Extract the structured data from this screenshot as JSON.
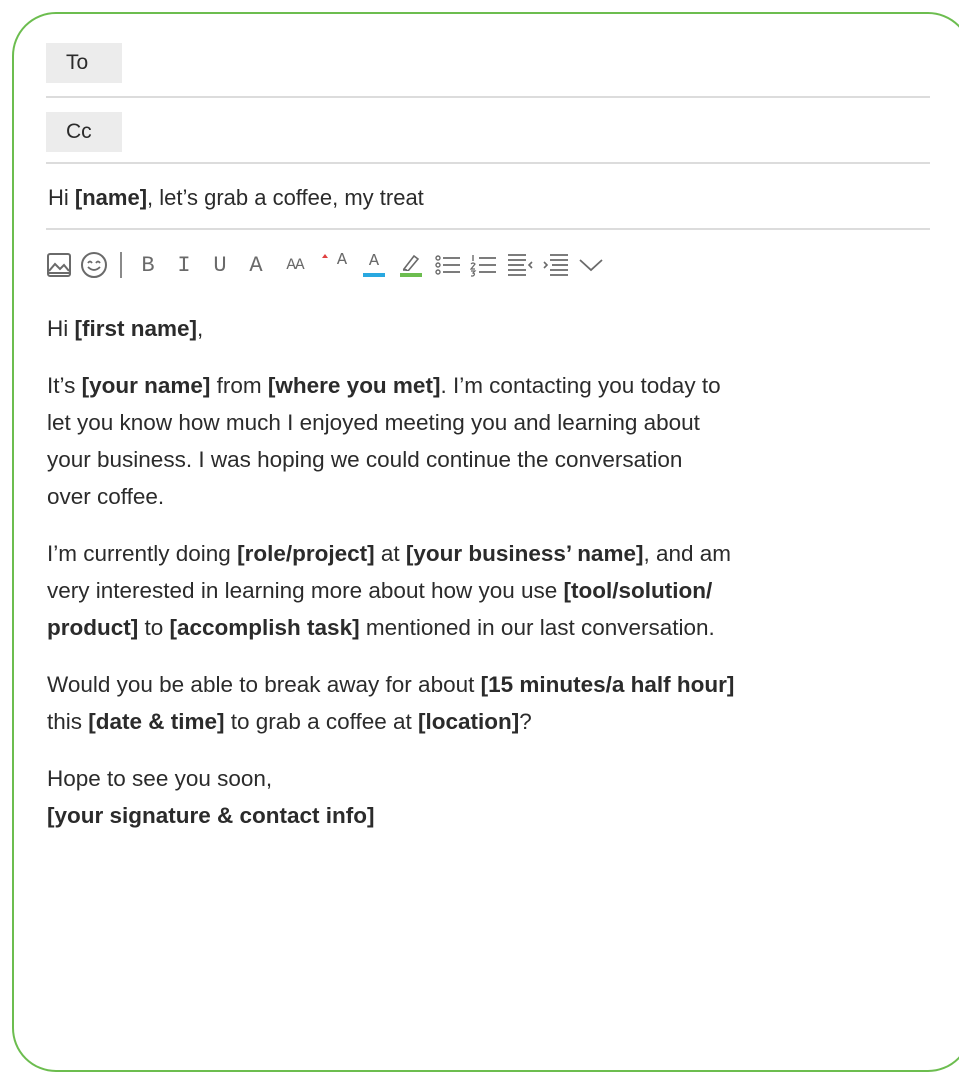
{
  "header": {
    "to_label": "To",
    "cc_label": "Cc"
  },
  "subject": {
    "prefix": "Hi ",
    "name_placeholder": "[name]",
    "suffix": ", let’s grab a coffee, my treat"
  },
  "toolbar": {
    "icons": [
      "image-icon",
      "emoji-icon"
    ],
    "bold_label": "B",
    "italic_label": "I",
    "underline_label": "U",
    "font_label": "A",
    "font_size_label": "AA",
    "superscript_label": "A",
    "text_color_label": "A",
    "text_color": "#29a8e0",
    "highlight_color": "#6cbd4f"
  },
  "body": {
    "greeting_prefix": "Hi ",
    "greeting_name": "[first name]",
    "greeting_suffix": ",",
    "p1": {
      "l1_a": "It’s ",
      "l1_b": "[your name]",
      "l1_c": " from ",
      "l1_d": "[where you met]",
      "l1_e": ". I’m contacting you today to",
      "l2": "let you know how much I enjoyed meeting you and learning about",
      "l3": "your business. I was hoping we could continue the conversation",
      "l4": "over coffee."
    },
    "p2": {
      "l1_a": "I’m currently doing ",
      "l1_b": "[role/project]",
      "l1_c": " at ",
      "l1_d": "[your business’ name]",
      "l1_e": ", and am",
      "l2_a": "very interested in learning more about how you use ",
      "l2_b": "[tool/solution/",
      "l3_a": "product]",
      "l3_b": " to ",
      "l3_c": "[accomplish task]",
      "l3_d": " mentioned in our last conversation."
    },
    "p3": {
      "l1_a": "Would you be able to break away for about ",
      "l1_b": "[15 minutes/a half hour]",
      "l2_a": "this ",
      "l2_b": "[date & time]",
      "l2_c": " to grab a coffee at ",
      "l2_d": "[location]",
      "l2_e": "?"
    },
    "closing": "Hope to see you soon,",
    "signature": "[your signature & contact info]"
  },
  "colors": {
    "frame": "#6cbd4f",
    "divider": "#dcdcdc",
    "tag_bg": "#ececec"
  }
}
